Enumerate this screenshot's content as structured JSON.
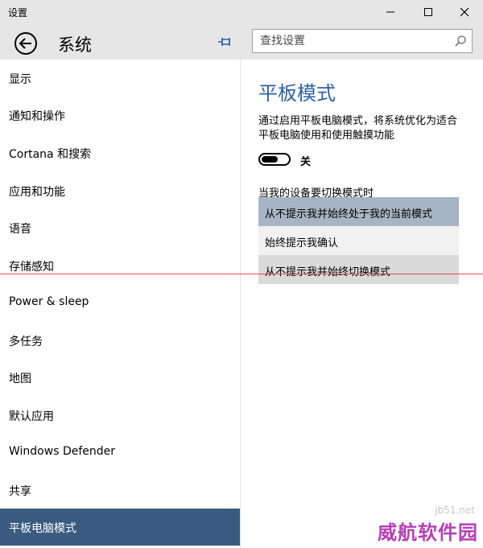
{
  "window": {
    "title": "设置"
  },
  "header": {
    "title": "系统",
    "search_placeholder": "查找设置"
  },
  "sidebar": {
    "items": [
      {
        "label": "显示"
      },
      {
        "label": "通知和操作"
      },
      {
        "label": "Cortana 和搜索"
      },
      {
        "label": "应用和功能"
      },
      {
        "label": "语音"
      },
      {
        "label": "存储感知"
      },
      {
        "label": "Power & sleep"
      },
      {
        "label": "多任务"
      },
      {
        "label": "地图"
      },
      {
        "label": "默认应用"
      },
      {
        "label": "Windows Defender"
      },
      {
        "label": "共享"
      },
      {
        "label": "平板电脑模式",
        "active": true
      }
    ]
  },
  "main": {
    "title": "平板模式",
    "description": "通过启用平板电脑模式，将系统优化为适合平板电脑使用和使用触摸功能",
    "toggle_state": "关",
    "switch_label": "当我的设备要切换模式时",
    "options": [
      {
        "label": "从不提示我并始终处于我的当前模式",
        "selected": true
      },
      {
        "label": "始终提示我确认"
      },
      {
        "label": "从不提示我并始终切换模式"
      }
    ]
  },
  "watermark": {
    "site": "jb51.net",
    "text": "威航软件园"
  },
  "colors": {
    "accent": "#2b5fa3",
    "active_nav": "#3a5a80",
    "selected_option": "#a7b4c3"
  }
}
